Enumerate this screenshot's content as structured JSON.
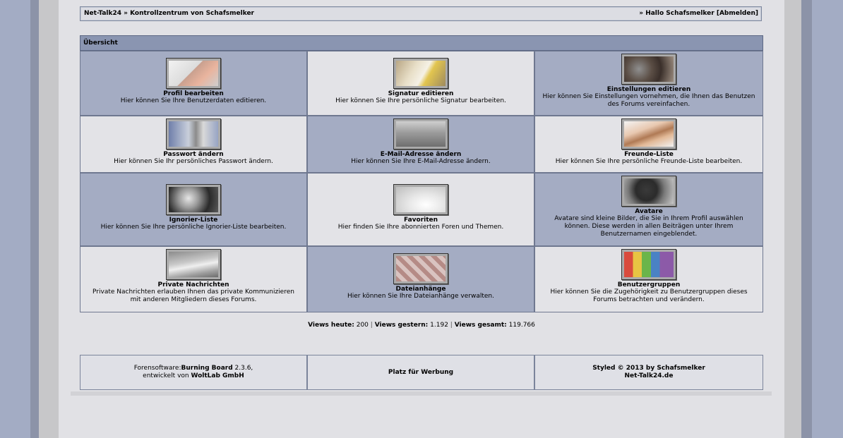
{
  "topbar": {
    "breadcrumb": "Net-Talk24 » Kontrollzentrum von Schafsmelker",
    "greeting": "» Hallo Schafsmelker [Abmelden]"
  },
  "panel": {
    "title": "Übersicht",
    "items": [
      {
        "title": "Profil bearbeiten",
        "desc": "Hier können Sie Ihre Benutzerdaten editieren.",
        "icon": "profile-edit-icon"
      },
      {
        "title": "Signatur editieren",
        "desc": "Hier können Sie Ihre persönliche Signatur bearbeiten.",
        "icon": "signature-icon"
      },
      {
        "title": "Einstellungen editieren",
        "desc": "Hier können Sie Einstellungen vornehmen, die Ihnen das Benutzen des Forums vereinfachen.",
        "icon": "settings-icon"
      },
      {
        "title": "Passwort ändern",
        "desc": "Hier können Sie Ihr persönliches Passwort ändern.",
        "icon": "password-icon"
      },
      {
        "title": "E-Mail-Adresse ändern",
        "desc": "Hier können Sie Ihre E-Mail-Adresse ändern.",
        "icon": "mailbox-icon"
      },
      {
        "title": "Freunde-Liste",
        "desc": "Hier können Sie Ihre persönliche Freunde-Liste bearbeiten.",
        "icon": "friends-icon"
      },
      {
        "title": "Ignorier-Liste",
        "desc": "Hier können Sie Ihre persönliche Ignorier-Liste bearbeiten.",
        "icon": "ignore-icon"
      },
      {
        "title": "Favoriten",
        "desc": "Hier finden Sie Ihre abonnierten Foren und Themen.",
        "icon": "favorites-icon"
      },
      {
        "title": "Avatare",
        "desc": "Avatare sind kleine Bilder, die Sie in Ihrem Profil auswählen können. Diese werden in allen Beiträgen unter Ihrem Benutzernamen eingeblendet.",
        "icon": "avatar-icon"
      },
      {
        "title": "Private Nachrichten",
        "desc": "Private Nachrichten erlauben Ihnen das private Kommunizieren mit anderen Mitgliedern dieses Forums.",
        "icon": "private-messages-icon"
      },
      {
        "title": "Dateianhänge",
        "desc": "Hier können Sie Ihre Dateianhänge verwalten.",
        "icon": "attachments-icon"
      },
      {
        "title": "Benutzergruppen",
        "desc": "Hier können Sie die Zugehörigkeit zu Benutzergruppen dieses Forums betrachten und verändern.",
        "icon": "usergroups-icon"
      }
    ]
  },
  "stats": {
    "today_label": "Views heute:",
    "today": "200",
    "yesterday_label": "Views gestern:",
    "yesterday": "1.192",
    "total_label": "Views gesamt:",
    "total": "119.766",
    "separator": "|"
  },
  "footer": {
    "software_prefix": "Forensoftware:",
    "software_name": "Burning Board",
    "software_version": " 2.3.6,",
    "developed_by": "entwickelt von",
    "developer": "WoltLab GmbH",
    "ad": "Platz für Werbung",
    "styled_by": "Styled © 2013 by Schafsmelker",
    "site": "Net-Talk24.de"
  }
}
